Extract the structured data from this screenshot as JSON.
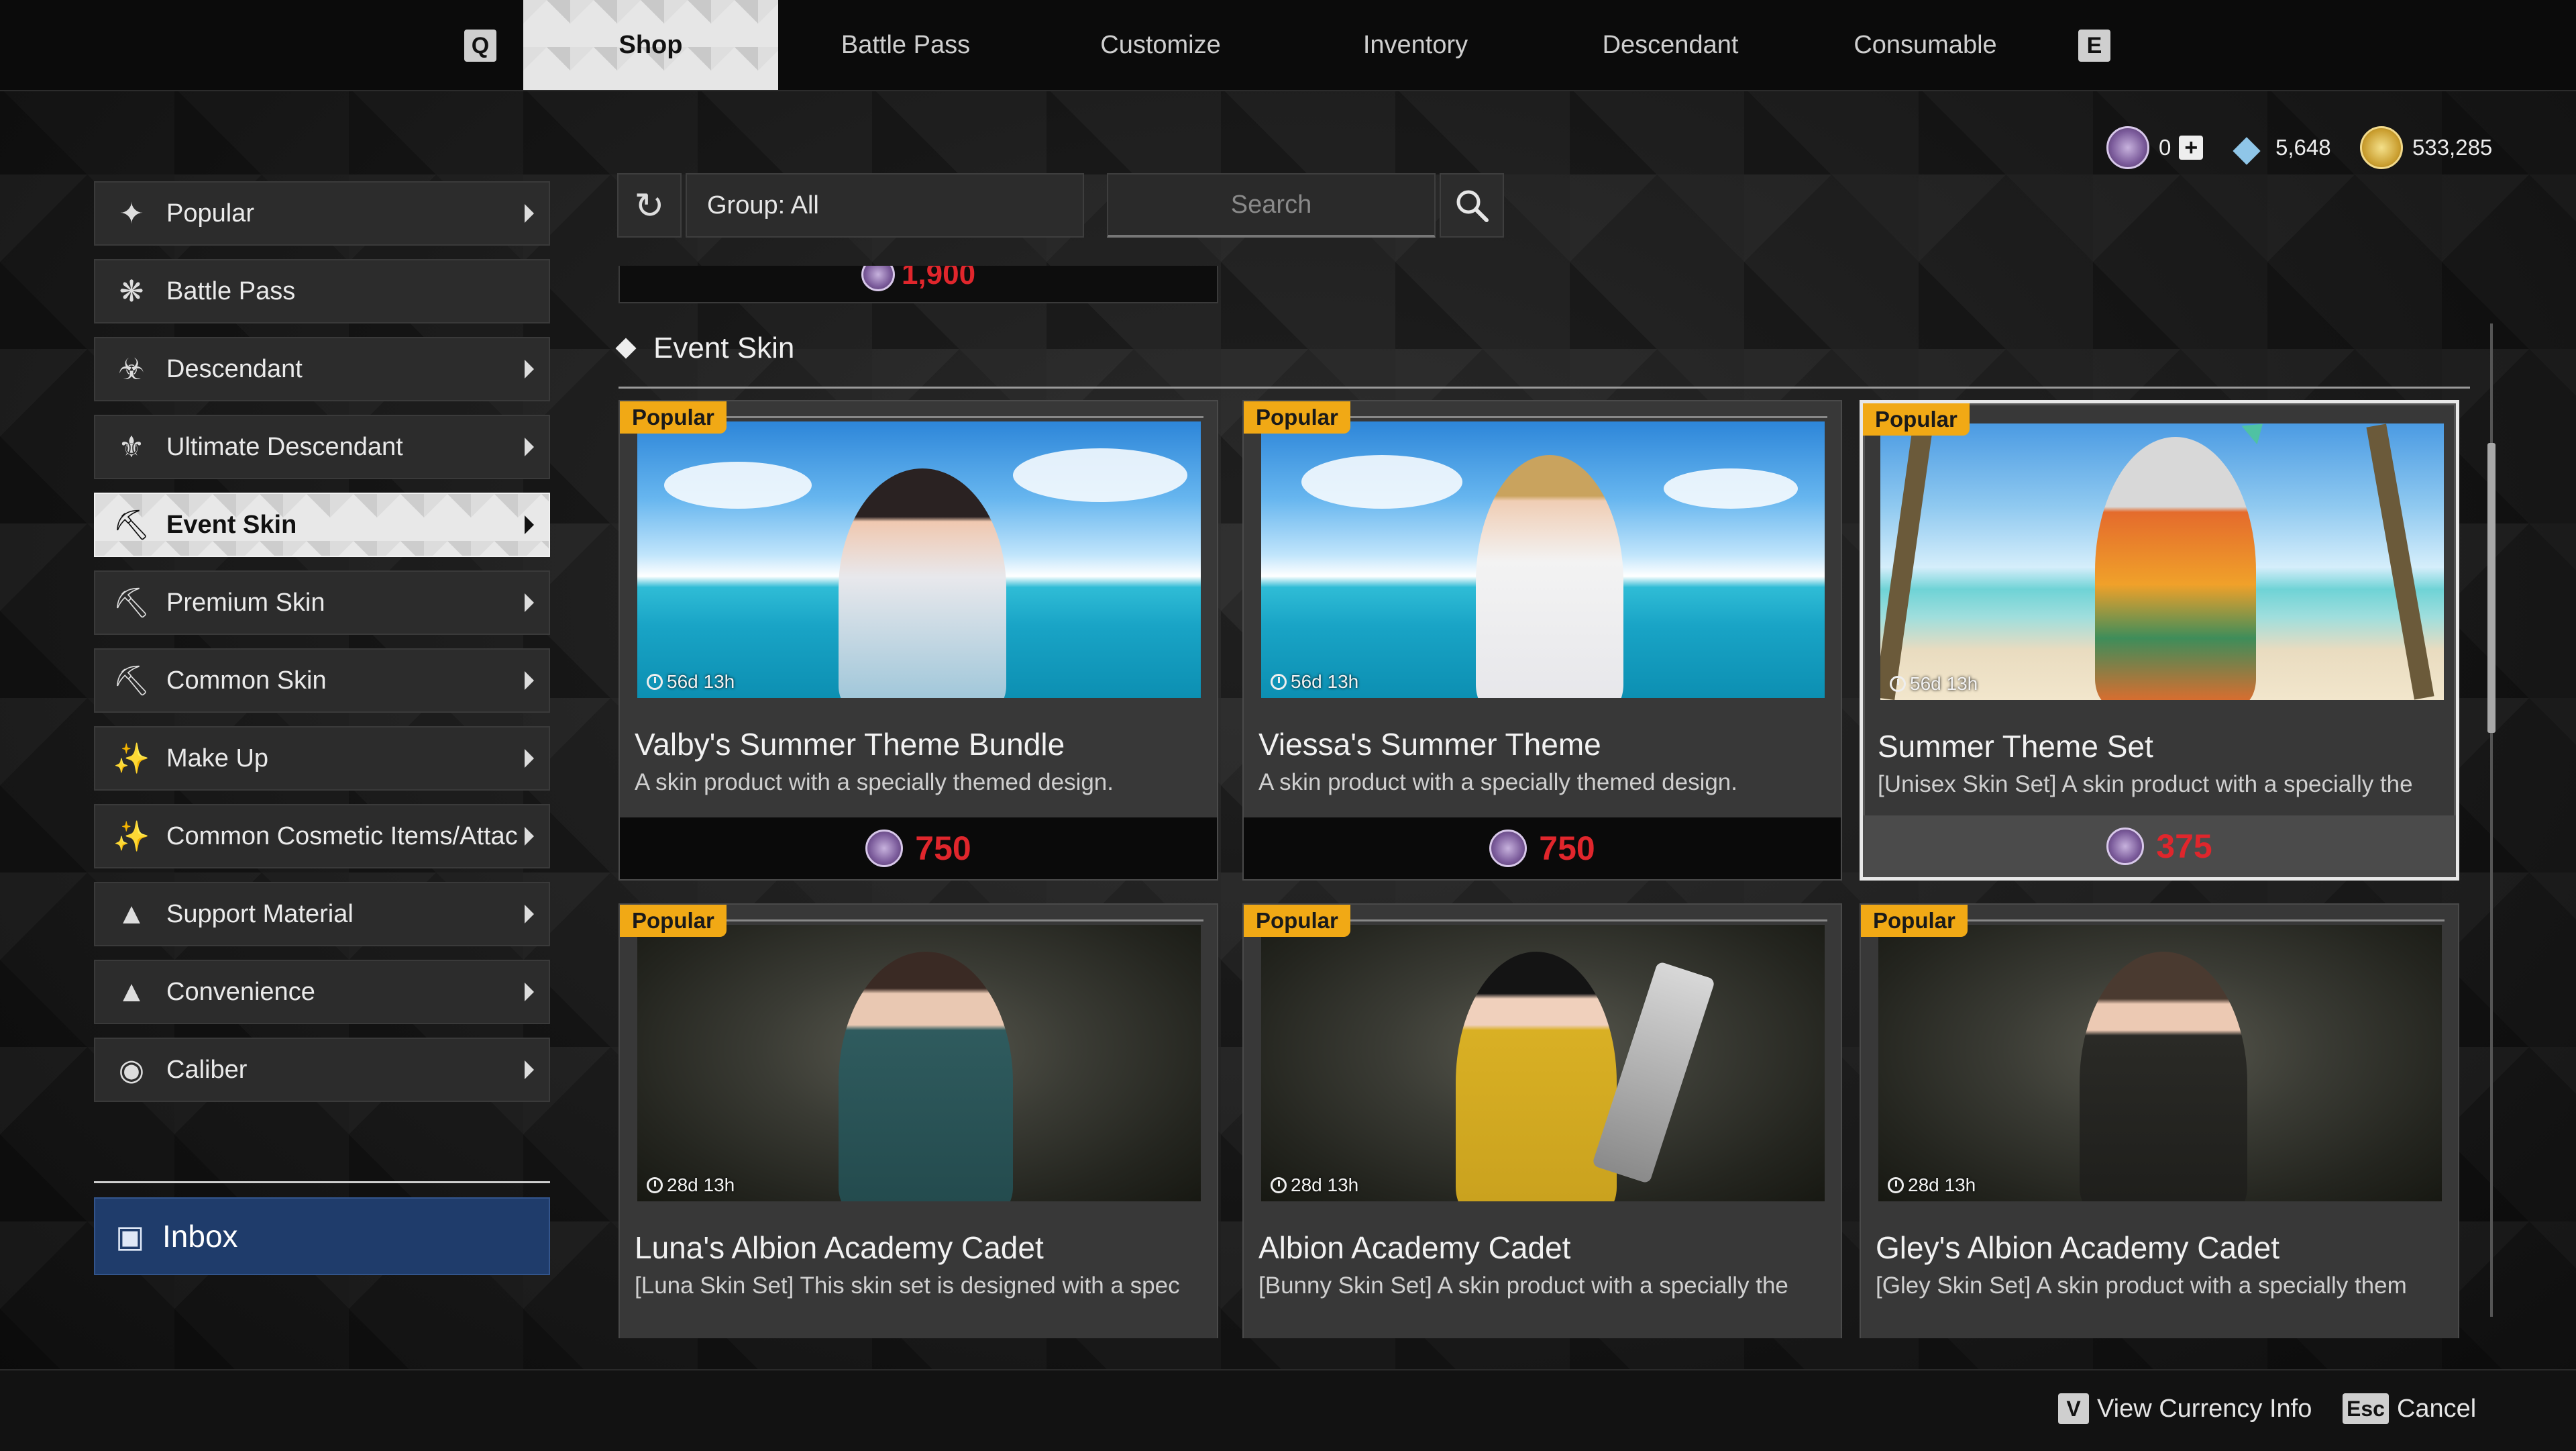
{
  "nav": {
    "prev_key": "Q",
    "next_key": "E",
    "tabs": [
      {
        "label": "Shop",
        "active": true
      },
      {
        "label": "Battle Pass"
      },
      {
        "label": "Customize"
      },
      {
        "label": "Inventory"
      },
      {
        "label": "Descendant"
      },
      {
        "label": "Consumable"
      }
    ]
  },
  "currency": {
    "caliber": "0",
    "kuiper": "5,648",
    "gold": "533,285"
  },
  "sidebar": {
    "items": [
      {
        "label": "Popular",
        "icon": "stars-icon"
      },
      {
        "label": "Battle Pass",
        "icon": "battle-pass-icon"
      },
      {
        "label": "Descendant",
        "icon": "descendant-icon"
      },
      {
        "label": "Ultimate Descendant",
        "icon": "ultimate-descendant-icon"
      },
      {
        "label": "Event Skin",
        "icon": "shirt-icon",
        "active": true
      },
      {
        "label": "Premium Skin",
        "icon": "shirt-icon"
      },
      {
        "label": "Common Skin",
        "icon": "shirt-icon"
      },
      {
        "label": "Make Up",
        "icon": "makeup-brush-icon"
      },
      {
        "label": "Common Cosmetic Items/Attac",
        "icon": "cosmetic-wand-icon"
      },
      {
        "label": "Support Material",
        "icon": "support-material-icon"
      },
      {
        "label": "Convenience",
        "icon": "convenience-icon"
      },
      {
        "label": "Caliber",
        "icon": "caliber-icon"
      }
    ],
    "inbox_label": "Inbox"
  },
  "filter": {
    "group_label": "Group: All",
    "search_placeholder": "Search"
  },
  "previous_row_price": "1,900",
  "section": {
    "title": "Event Skin",
    "cards": [
      {
        "badge": "Popular",
        "timer": "56d 13h",
        "title": "Valby's Summer Theme Bundle",
        "desc": "A skin product with a specially themed design.",
        "price": "750",
        "selected": false
      },
      {
        "badge": "Popular",
        "timer": "56d 13h",
        "title": "Viessa's Summer Theme",
        "desc": "A skin product with a specially themed design.",
        "price": "750",
        "selected": false
      },
      {
        "badge": "Popular",
        "timer": "56d 13h",
        "title": "Summer Theme Set",
        "desc": "[Unisex Skin Set] A skin product with a specially the",
        "price": "375",
        "selected": true
      },
      {
        "badge": "Popular",
        "timer": "28d 13h",
        "title": "Luna's Albion Academy Cadet",
        "desc": "[Luna Skin Set] This skin set is designed with a spec",
        "price": "",
        "selected": false
      },
      {
        "badge": "Popular",
        "timer": "28d 13h",
        "title": "Albion Academy Cadet",
        "desc": "[Bunny Skin Set] A skin product with a specially the",
        "price": "",
        "selected": false
      },
      {
        "badge": "Popular",
        "timer": "28d 13h",
        "title": "Gley's Albion Academy Cadet",
        "desc": "[Gley Skin Set] A skin product with a specially them",
        "price": "",
        "selected": false
      }
    ]
  },
  "footer": {
    "currency_info_key": "V",
    "currency_info_label": "View Currency Info",
    "cancel_key": "Esc",
    "cancel_label": "Cancel"
  },
  "colors": {
    "price_red": "#e0262c",
    "badge_orange": "#f1a915",
    "inbox_blue": "#1f3c6b"
  }
}
